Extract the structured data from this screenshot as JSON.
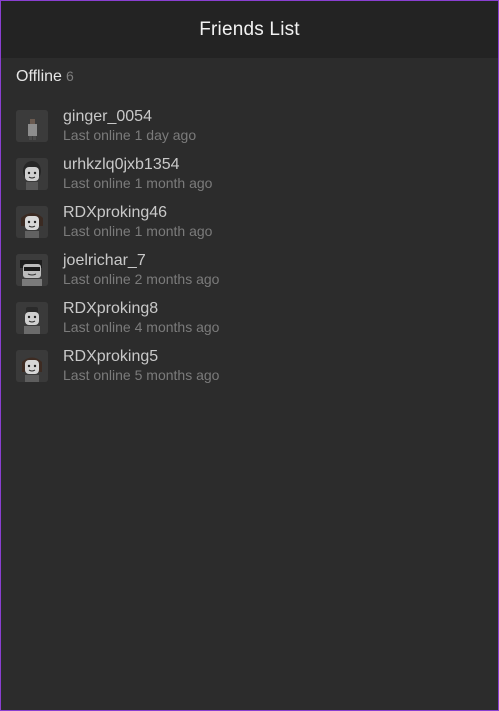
{
  "header": {
    "title": "Friends List"
  },
  "section": {
    "label": "Offline",
    "count": "6"
  },
  "friends": [
    {
      "name": "ginger_0054",
      "status": "Last online 1 day ago",
      "avatar": "avatar-ginger"
    },
    {
      "name": "urhkzlq0jxb1354",
      "status": "Last online 1 month ago",
      "avatar": "avatar-urhkzlq"
    },
    {
      "name": "RDXproking46",
      "status": "Last online 1 month ago",
      "avatar": "avatar-rdx46"
    },
    {
      "name": "joelrichar_7",
      "status": "Last online 2 months ago",
      "avatar": "avatar-joel"
    },
    {
      "name": "RDXproking8",
      "status": "Last online 4 months ago",
      "avatar": "avatar-rdx8"
    },
    {
      "name": "RDXproking5",
      "status": "Last online 5 months ago",
      "avatar": "avatar-rdx5"
    }
  ],
  "colors": {
    "border": "#8a3fd1",
    "background": "#2c2c2c",
    "header": "#232323"
  }
}
